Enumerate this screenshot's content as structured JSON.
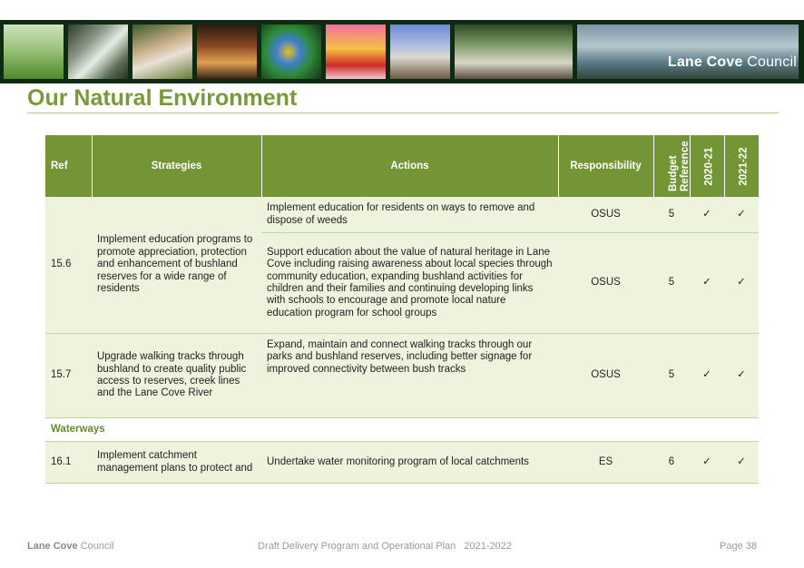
{
  "header": {
    "brand_bold": "Lane Cove",
    "brand_light": "Council",
    "photos": [
      "golf-course-photo",
      "creek-photo",
      "dancers-photo",
      "street-dining-photo",
      "parrot-photo",
      "performer-photo",
      "building-photo",
      "outdoor-market-photo",
      "harbour-photo"
    ]
  },
  "page": {
    "title": "Our Natural Environment"
  },
  "table": {
    "headers": {
      "ref": "Ref",
      "strategies": "Strategies",
      "actions": "Actions",
      "responsibility": "Responsibility",
      "budget": "Budget Reference",
      "y1": "2020-21",
      "y2": "2021-22"
    },
    "rows": [
      {
        "ref": "15.6",
        "strategy": "Implement education programs to promote appreciation, protection and enhancement of bushland reserves for a wide range of residents",
        "actions": [
          {
            "action": "Implement education for residents on ways to remove and dispose of weeds",
            "responsibility": "OSUS",
            "budget": "5",
            "y1": "✓",
            "y2": "✓"
          },
          {
            "action": "Support education about the value of natural heritage in Lane Cove including raising awareness about local species through community education, expanding bushland activities for children and their families and continuing developing links with schools to encourage and promote local nature education program for school groups",
            "responsibility": "OSUS",
            "budget": "5",
            "y1": "✓",
            "y2": "✓"
          }
        ]
      },
      {
        "ref": "15.7",
        "strategy": "Upgrade walking tracks through bushland to create quality public access to reserves, creek lines and the Lane Cove River",
        "actions": [
          {
            "action": "Expand, maintain and connect walking tracks through our parks and bushland reserves, including better signage for improved connectivity between bush tracks",
            "responsibility": "OSUS",
            "budget": "5",
            "y1": "✓",
            "y2": "✓"
          }
        ]
      }
    ],
    "section": "Waterways",
    "rows2": [
      {
        "ref": "16.1",
        "strategy": "Implement catchment management plans to protect and",
        "actions": [
          {
            "action": "Undertake water monitoring program of local catchments",
            "responsibility": "ES",
            "budget": "6",
            "y1": "✓",
            "y2": "✓"
          }
        ]
      }
    ]
  },
  "footer": {
    "org_bold": "Lane Cove",
    "org_light": "Council",
    "doc": "Draft Delivery Program and Operational Plan   2021-2022",
    "page": "Page 38"
  },
  "colors": {
    "header_green": "#739535",
    "title_green": "#7a9a3a",
    "row_background": "#eef3dd",
    "banner_dark": "#0f2a12"
  }
}
